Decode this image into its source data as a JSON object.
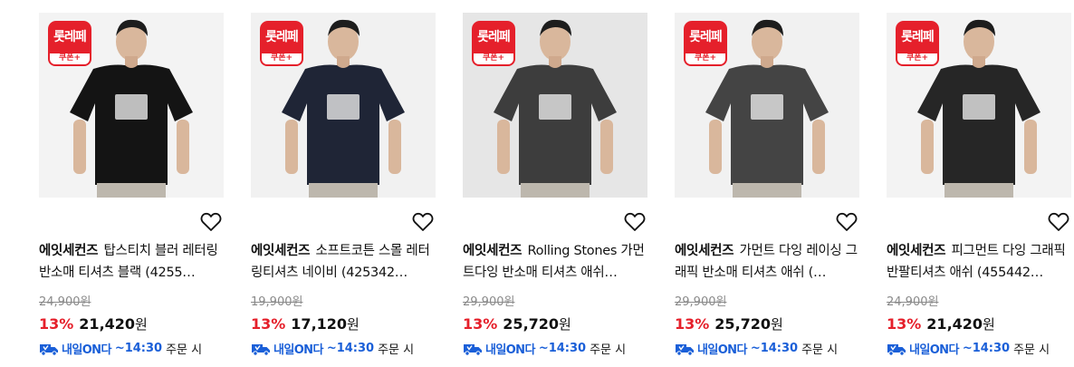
{
  "badge": {
    "top": "롯레페",
    "bottom": "쿠폰+"
  },
  "delivery": {
    "tag": "내일ON다",
    "time": "~14:30",
    "tail": "주문 시"
  },
  "products": [
    {
      "brand": "에잇세컨즈",
      "name": "탑스티치 블러 레터링 반소매 티셔츠 블랙 (4255…",
      "original_price": "24,900",
      "discount": "13%",
      "price": "21,420",
      "currency": "원",
      "shirt_color": "#141414",
      "bg_color": "#f3f3f3"
    },
    {
      "brand": "에잇세컨즈",
      "name": "소프트코튼 스몰 레터링티셔츠 네이비 (425342…",
      "original_price": "19,900",
      "discount": "13%",
      "price": "17,120",
      "currency": "원",
      "shirt_color": "#1f2536",
      "bg_color": "#f1f1f1"
    },
    {
      "brand": "에잇세컨즈",
      "name": "Rolling Stones 가먼트다잉 반소매 티셔츠 애쉬…",
      "original_price": "29,900",
      "discount": "13%",
      "price": "25,720",
      "currency": "원",
      "shirt_color": "#3d3d3d",
      "bg_color": "#e6e6e6"
    },
    {
      "brand": "에잇세컨즈",
      "name": "가먼트 다잉 레이싱 그래픽 반소매 티셔츠 애쉬 (…",
      "original_price": "29,900",
      "discount": "13%",
      "price": "25,720",
      "currency": "원",
      "shirt_color": "#444444",
      "bg_color": "#f1f1f1"
    },
    {
      "brand": "에잇세컨즈",
      "name": "피그먼트 다잉 그래픽 반팔티셔츠 애쉬 (455442…",
      "original_price": "24,900",
      "discount": "13%",
      "price": "21,420",
      "currency": "원",
      "shirt_color": "#262626",
      "bg_color": "#f3f3f3"
    }
  ]
}
